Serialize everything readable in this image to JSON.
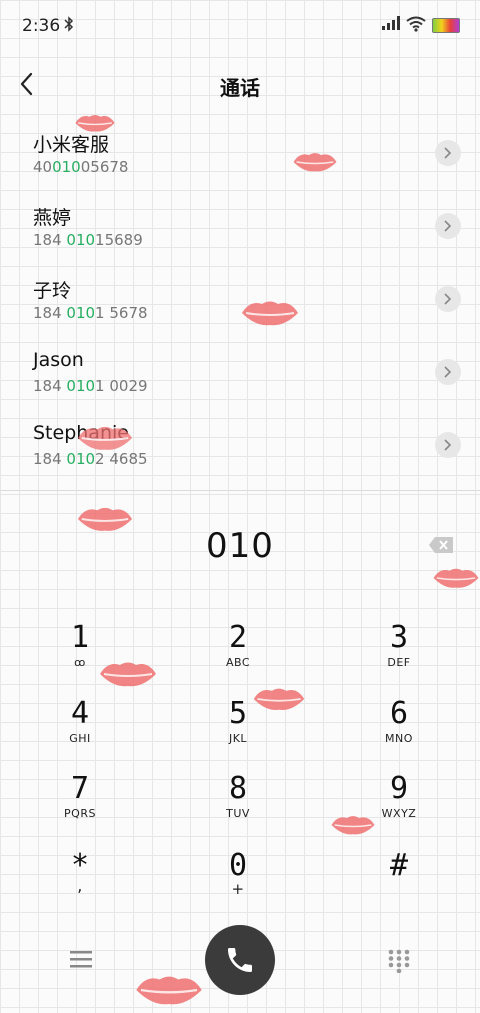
{
  "status": {
    "time": "2:36"
  },
  "header": {
    "title": "通话"
  },
  "contacts": [
    {
      "name": "小米客服",
      "num_pre": "40",
      "num_hl": "010",
      "num_post": "05678"
    },
    {
      "name": "燕婷",
      "num_pre": "184 ",
      "num_hl": "010",
      "num_post": "15689"
    },
    {
      "name": "子玲",
      "num_pre": "184 ",
      "num_hl": "010",
      "num_post": "1 5678"
    },
    {
      "name": "Jason",
      "num_pre": "184 ",
      "num_hl": "010",
      "num_post": "1 0029"
    },
    {
      "name": "Stephanie",
      "num_pre": "184 ",
      "num_hl": "010",
      "num_post": "2 4685"
    }
  ],
  "dialer": {
    "entered": "010",
    "keys": [
      {
        "digit": "1",
        "letters": "ꝏ"
      },
      {
        "digit": "2",
        "letters": "ABC"
      },
      {
        "digit": "3",
        "letters": "DEF"
      },
      {
        "digit": "4",
        "letters": "GHI"
      },
      {
        "digit": "5",
        "letters": "JKL"
      },
      {
        "digit": "6",
        "letters": "MNO"
      },
      {
        "digit": "7",
        "letters": "PQRS"
      },
      {
        "digit": "8",
        "letters": "TUV"
      },
      {
        "digit": "9",
        "letters": "WXYZ"
      },
      {
        "digit": "*",
        "letters": ","
      },
      {
        "digit": "0",
        "letters": "+"
      },
      {
        "digit": "#",
        "letters": ""
      }
    ]
  },
  "icons": {
    "back": "back-arrow-icon",
    "call": "phone-icon",
    "menu": "menu-icon",
    "keypad": "keypad-icon",
    "backspace": "backspace-icon",
    "decoration": "lips-icon"
  },
  "colors": {
    "highlight": "#27ae60",
    "call_button": "#3b3b3b",
    "lips": "#ef6f6f"
  }
}
